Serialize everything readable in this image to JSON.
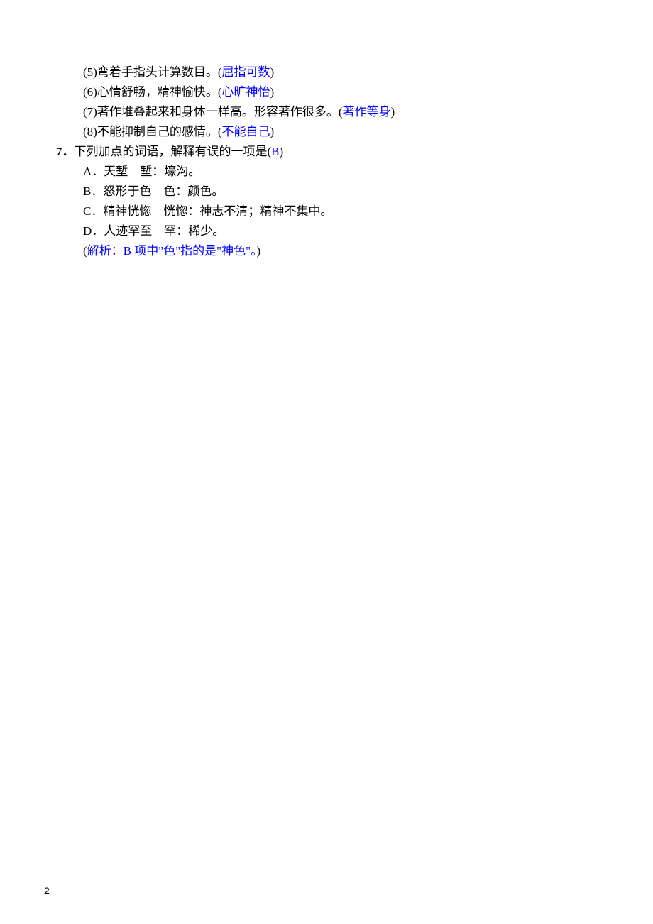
{
  "fills": [
    {
      "num": "(5)",
      "text": "弯着手指头计算数目。(",
      "ans": "屈指可数",
      "tail": ")"
    },
    {
      "num": "(6)",
      "text": "心情舒畅，精神愉快。(",
      "ans": "心旷神怡",
      "tail": ")"
    },
    {
      "num": "(7)",
      "text": "著作堆叠起来和身体一样高。形容著作很多。(",
      "ans": "著作等身",
      "tail": ")"
    },
    {
      "num": "(8)",
      "text": "不能抑制自己的感情。(",
      "ans": "不能自己",
      "tail": ")"
    }
  ],
  "q7": {
    "num": "7．",
    "stem_pre": "下列加点的词语，解释有误的一项是(",
    "ans": "B",
    "stem_post": ")",
    "options": [
      "A．天堑　堑：壕沟。",
      "B．怒形于色　色：颜色。",
      "C．精神恍惚　恍惚：神志不清；精神不集中。",
      "D．人迹罕至　罕：稀少。"
    ],
    "analysis_pre": "(",
    "analysis": "解析：B 项中\"色\"指的是\"神色\"。",
    "analysis_post": ")"
  },
  "page_number": "2"
}
